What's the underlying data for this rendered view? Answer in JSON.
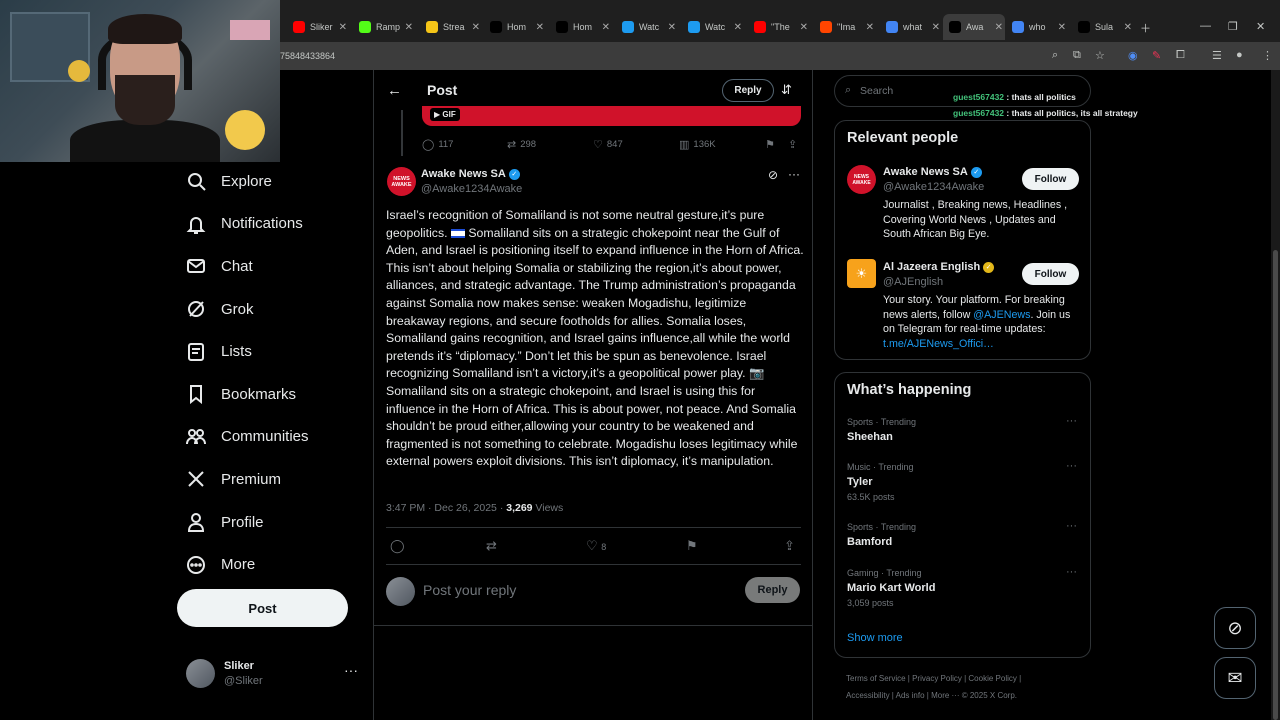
{
  "browser": {
    "tabs": [
      {
        "label": "Sliker",
        "icon": "youtube-icon",
        "color": "#ff0000"
      },
      {
        "label": "Ramp",
        "icon": "kick-icon",
        "color": "#53fc18"
      },
      {
        "label": "Strea",
        "icon": "streamelements-icon",
        "color": "#f5c518"
      },
      {
        "label": "Hom",
        "icon": "x-icon",
        "color": "#000000"
      },
      {
        "label": "Hom",
        "icon": "x-icon",
        "color": "#000000"
      },
      {
        "label": "Watc",
        "icon": "watch-icon",
        "color": "#1d9bf0"
      },
      {
        "label": "Watc",
        "icon": "watch-icon",
        "color": "#1d9bf0"
      },
      {
        "label": "\"The",
        "icon": "youtube-icon",
        "color": "#ff0000"
      },
      {
        "label": "\"Ima",
        "icon": "reddit-icon",
        "color": "#ff4500"
      },
      {
        "label": "what",
        "icon": "google-icon",
        "color": "#4285f4"
      },
      {
        "label": "Awa",
        "icon": "x-icon",
        "color": "#000000"
      },
      {
        "label": "who",
        "icon": "google-icon",
        "color": "#4285f4"
      },
      {
        "label": "Sula",
        "icon": "x-icon",
        "color": "#000000"
      }
    ],
    "url": "75848433864"
  },
  "nav": {
    "items": [
      {
        "label": "Explore",
        "icon": "search-icon"
      },
      {
        "label": "Notifications",
        "icon": "bell-icon"
      },
      {
        "label": "Chat",
        "icon": "mail-icon"
      },
      {
        "label": "Grok",
        "icon": "grok-icon"
      },
      {
        "label": "Lists",
        "icon": "list-icon"
      },
      {
        "label": "Bookmarks",
        "icon": "bookmark-icon"
      },
      {
        "label": "Communities",
        "icon": "communities-icon"
      },
      {
        "label": "Premium",
        "icon": "x-logo-icon"
      },
      {
        "label": "Profile",
        "icon": "person-icon"
      },
      {
        "label": "More",
        "icon": "more-circle-icon"
      }
    ],
    "post_label": "Post",
    "account": {
      "name": "Sliker",
      "handle": "@Sliker"
    }
  },
  "header": {
    "title": "Post",
    "reply_label": "Reply"
  },
  "parent_post": {
    "gif_label": "GIF",
    "replies": "117",
    "reposts": "298",
    "likes": "847",
    "views": "136K"
  },
  "tweet": {
    "avatar_text": "NEWS AWAKE",
    "name": "Awake News SA",
    "handle": "@Awake1234Awake",
    "text_parts": [
      "Israel’s recognition of Somaliland is not some neutral gesture,it’s pure geopolitics. ",
      " Somaliland sits on a strategic chokepoint near the Gulf of Aden, and Israel is positioning itself to expand influence in the Horn of Africa. This isn’t about helping Somalia or stabilizing the region,it’s about power, alliances, and strategic advantage.  The Trump administration’s propaganda against Somalia now makes sense: weaken Mogadishu, legitimize breakaway regions, and secure footholds for allies.  Somalia loses, Somaliland gains recognition, and Israel gains influence,all while the world pretends it’s “diplomacy.” Don’t let this be spun as benevolence. Israel recognizing Somaliland isn’t a victory,it’s a geopolitical power play. ",
      " Somaliland sits on a strategic chokepoint, and Israel is using this for influence in the Horn of Africa. This is about power, not peace.  And Somalia shouldn’t be proud either,allowing your country to be weakened and fragmented is not something to celebrate. Mogadishu loses legitimacy while external powers exploit divisions. This isn’t diplomacy, it’s manipulation."
    ],
    "time": "3:47 PM · Dec 26, 2025 · ",
    "views_count": "3,269",
    "views_label": " Views",
    "likes": "8"
  },
  "compose": {
    "placeholder": "Post your reply",
    "button": "Reply"
  },
  "search": {
    "placeholder": "Search"
  },
  "chat_overlay": [
    {
      "user": "guest567432",
      "msg": " : thats all politics"
    },
    {
      "user": "guest567432",
      "msg": " : thats all politics, its all strategy"
    }
  ],
  "relevant": {
    "title": "Relevant people",
    "people": [
      {
        "name": "Awake News SA",
        "handle": "@Awake1234Awake",
        "bio": "Journalist , Breaking news, Headlines , Covering World News , Updates and South African Big Eye.",
        "follow": "Follow",
        "badge": "blue"
      },
      {
        "name": "Al Jazeera English",
        "handle": "@AJEnglish",
        "bio_pre": "Your story. Your platform. For breaking news alerts, follow ",
        "bio_link": "@AJENews",
        "bio_mid": ". Join us on Telegram for real-time updates: ",
        "bio_link2": "t.me/AJENews_Offici…",
        "follow": "Follow",
        "badge": "gold"
      }
    ]
  },
  "trending": {
    "title": "What’s happening",
    "items": [
      {
        "context": "Sports · Trending",
        "name": "Sheehan",
        "count": ""
      },
      {
        "context": "Music · Trending",
        "name": "Tyler",
        "count": "63.5K posts"
      },
      {
        "context": "Sports · Trending",
        "name": "Bamford",
        "count": ""
      },
      {
        "context": "Gaming · Trending",
        "name": "Mario Kart World",
        "count": "3,059 posts"
      }
    ],
    "show_more": "Show more"
  },
  "footer": {
    "line1": "Terms of Service  |  Privacy Policy  |  Cookie Policy  |",
    "line2": "Accessibility  |  Ads info  |  More ···  © 2025 X Corp."
  },
  "colors": {
    "accent": "#1d9bf0",
    "border": "#2f3336",
    "muted": "#71767b"
  }
}
